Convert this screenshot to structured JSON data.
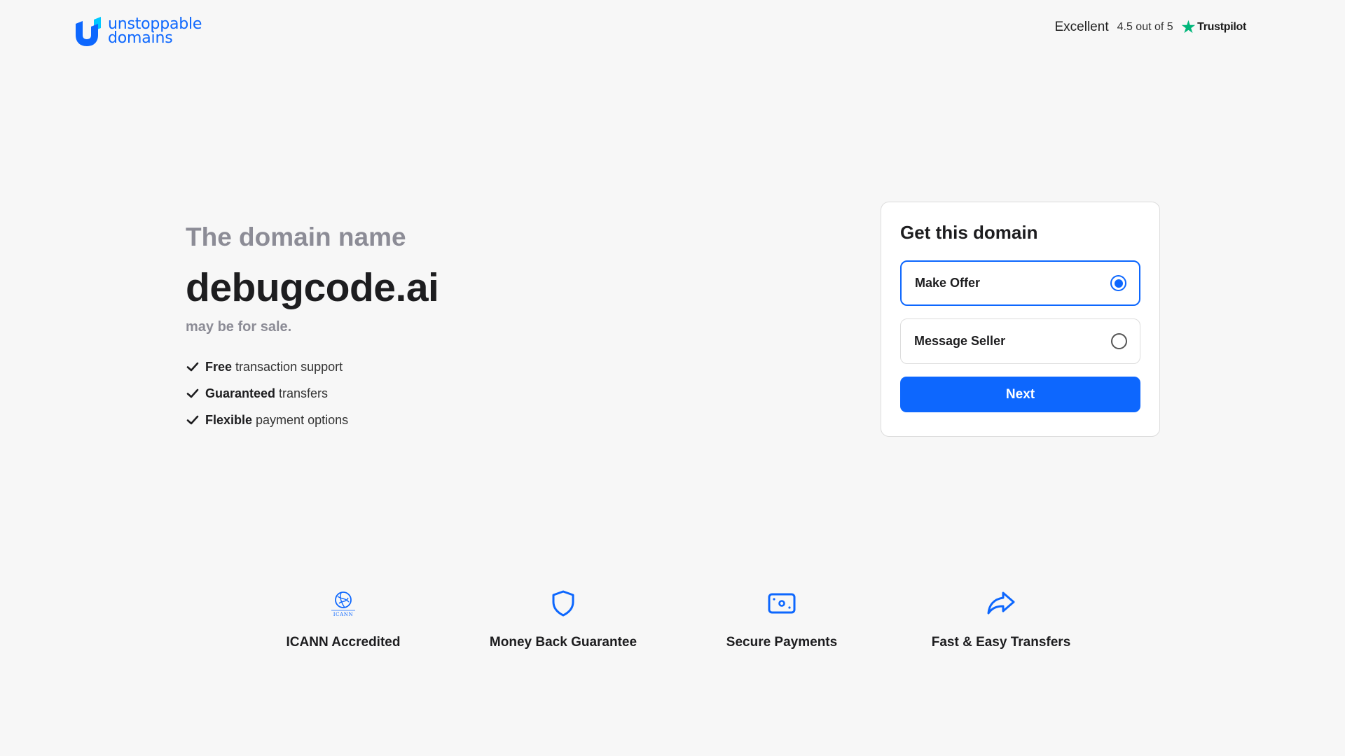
{
  "brand": {
    "line1": "unstoppable",
    "line2": "domains"
  },
  "trustpilot": {
    "label": "Excellent",
    "rating": "4.5 out of 5",
    "brand": "Trustpilot"
  },
  "hero": {
    "kicker": "The domain name",
    "domain": "debugcode.ai",
    "subtitle": "may be for sale.",
    "features": [
      {
        "bold": "Free",
        "rest": "transaction support"
      },
      {
        "bold": "Guaranteed",
        "rest": "transfers"
      },
      {
        "bold": "Flexible",
        "rest": "payment options"
      }
    ]
  },
  "card": {
    "title": "Get this domain",
    "options": [
      {
        "label": "Make Offer",
        "selected": true
      },
      {
        "label": "Message Seller",
        "selected": false
      }
    ],
    "next_label": "Next"
  },
  "badges": [
    {
      "label": "ICANN Accredited",
      "icon": "icann-globe-icon"
    },
    {
      "label": "Money Back Guarantee",
      "icon": "shield-icon"
    },
    {
      "label": "Secure Payments",
      "icon": "payment-card-icon"
    },
    {
      "label": "Fast & Easy Transfers",
      "icon": "share-arrow-icon"
    }
  ],
  "colors": {
    "accent": "#0d67fe",
    "muted": "#8c8c96",
    "background": "#f7f7f7",
    "trustpilot_green": "#00b67a"
  }
}
